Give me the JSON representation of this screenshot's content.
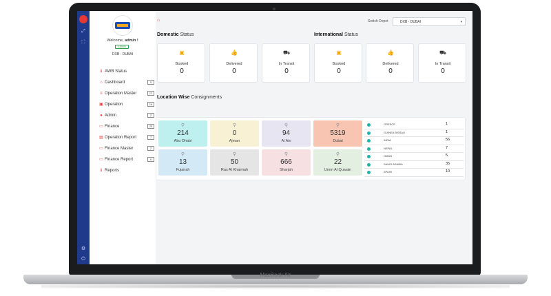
{
  "brand": "MacBook Air",
  "sidebar": {
    "welcome_prefix": "Welcome,",
    "user": "admin !",
    "badge": "ADMIN",
    "depot": "DXB - DUBAI",
    "items": [
      {
        "label": "AWB Status",
        "icon": "info-icon",
        "count": ""
      },
      {
        "label": "Dashboard",
        "icon": "home-icon",
        "count": "5"
      },
      {
        "label": "Operation Master",
        "icon": "list-icon",
        "count": "12"
      },
      {
        "label": "Operation",
        "icon": "clipboard-icon",
        "count": "16"
      },
      {
        "label": "Admin",
        "icon": "user-icon",
        "count": "2"
      },
      {
        "label": "Finance",
        "icon": "money-icon",
        "count": "25"
      },
      {
        "label": "Operation Report",
        "icon": "report-icon",
        "count": "7"
      },
      {
        "label": "Finance Master",
        "icon": "money-icon",
        "count": "2"
      },
      {
        "label": "Finance Report",
        "icon": "money-icon",
        "count": "6"
      },
      {
        "label": "Reports",
        "icon": "info-icon",
        "count": ""
      }
    ]
  },
  "header": {
    "switch_depot_label": "Switch Depot",
    "selected_depot": "DXB - DUBAI"
  },
  "domestic": {
    "title_bold": "Domestic",
    "title_rest": "Status",
    "cards": [
      {
        "label": "Booked",
        "value": "0",
        "icon": "booked-icon"
      },
      {
        "label": "Delivered",
        "value": "0",
        "icon": "thumbs-up-icon"
      },
      {
        "label": "In Transit",
        "value": "0",
        "icon": "truck-icon"
      }
    ]
  },
  "international": {
    "title_bold": "International",
    "title_rest": "Status",
    "cards": [
      {
        "label": "Booked",
        "value": "0",
        "icon": "booked-icon"
      },
      {
        "label": "Delivered",
        "value": "0",
        "icon": "thumbs-up-icon"
      },
      {
        "label": "In Transit",
        "value": "0",
        "icon": "truck-icon"
      }
    ]
  },
  "location": {
    "title_bold": "Location Wise",
    "title_rest": "Consignments",
    "tiles": [
      {
        "value": "214",
        "label": "Abu Dhabi",
        "color": "#bff0f0"
      },
      {
        "value": "0",
        "label": "Ajman",
        "color": "#f8f1d3"
      },
      {
        "value": "94",
        "label": "Al Ain",
        "color": "#e8e5f2"
      },
      {
        "value": "5319",
        "label": "Dubai",
        "color": "#f8c5b3"
      },
      {
        "value": "13",
        "label": "Fujairah",
        "color": "#d4e9f6"
      },
      {
        "value": "50",
        "label": "Ras Al Khaimah",
        "color": "#e5e5e5"
      },
      {
        "value": "666",
        "label": "Sharjah",
        "color": "#f6e0e2"
      },
      {
        "value": "22",
        "label": "Umm Al Quwain",
        "color": "#e3efe0"
      }
    ],
    "countries": [
      {
        "name": "GREECE",
        "value": "1"
      },
      {
        "name": "GUINEA BISSAU",
        "value": "1"
      },
      {
        "name": "INDIA",
        "value": "56"
      },
      {
        "name": "NEPAL",
        "value": "7"
      },
      {
        "name": "OMAN",
        "value": "5"
      },
      {
        "name": "SAUDI ARABIA",
        "value": "35"
      },
      {
        "name": "SPAIN",
        "value": "10"
      }
    ]
  }
}
